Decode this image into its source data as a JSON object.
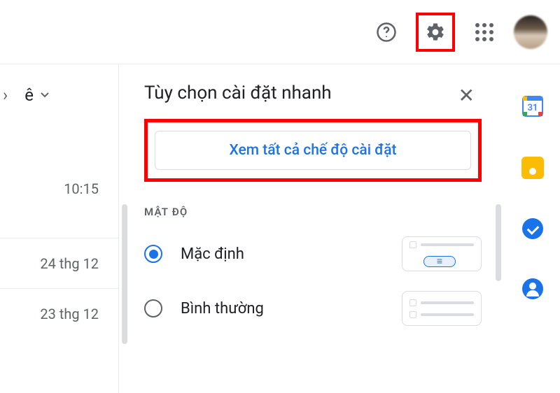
{
  "header": {
    "help_tooltip": "Help",
    "settings_tooltip": "Settings",
    "apps_tooltip": "Google apps"
  },
  "left": {
    "chevron": "›",
    "menu_letter": "ê",
    "dates": {
      "time": "10:15",
      "d1": "24 thg 12",
      "d2": "23 thg 12"
    }
  },
  "panel": {
    "title": "Tùy chọn cài đặt nhanh",
    "close": "✕",
    "all_settings": "Xem tất cả chế độ cài đặt",
    "density": {
      "section_label": "MẬT ĐỘ",
      "opt_default": "Mặc định",
      "opt_comfortable": "Bình thường"
    }
  },
  "side": {
    "calendar": "31"
  }
}
